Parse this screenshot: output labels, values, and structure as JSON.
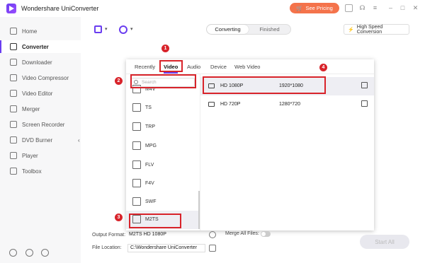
{
  "app": {
    "title": "Wondershare UniConverter",
    "pricing_label": "See Pricing"
  },
  "sidebar": {
    "items": [
      {
        "label": "Home"
      },
      {
        "label": "Converter"
      },
      {
        "label": "Downloader"
      },
      {
        "label": "Video Compressor"
      },
      {
        "label": "Video Editor"
      },
      {
        "label": "Merger"
      },
      {
        "label": "Screen Recorder"
      },
      {
        "label": "DVD Burner"
      },
      {
        "label": "Player"
      },
      {
        "label": "Toolbox"
      }
    ],
    "active": "Converter"
  },
  "toolbar": {
    "tabs": [
      "Converting",
      "Finished"
    ],
    "active_tab": "Converting",
    "high_speed_label": "High Speed Conversion"
  },
  "popup": {
    "tabs": [
      "Recently",
      "Video",
      "Audio",
      "Device",
      "Web Video"
    ],
    "active_tab": "Video",
    "search_placeholder": "Search",
    "formats": [
      "M4V",
      "TS",
      "TRP",
      "MPG",
      "FLV",
      "F4V",
      "SWF",
      "M2TS"
    ],
    "selected_format": "M2TS",
    "presets": [
      {
        "name": "HD 1080P",
        "resolution": "1920*1080"
      },
      {
        "name": "HD 720P",
        "resolution": "1280*720"
      }
    ],
    "selected_preset": "HD 1080P"
  },
  "annotations": [
    "1",
    "2",
    "3",
    "4"
  ],
  "bottom": {
    "output_format_label": "Output Format:",
    "output_format_value": "M2TS HD 1080P",
    "merge_label": "Merge All Files:",
    "file_location_label": "File Location:",
    "file_location_value": "C:\\Wondershare UniConverter",
    "start_all_label": "Start All"
  },
  "colors": {
    "accent": "#6a3df0",
    "pricing": "#f4734b",
    "annotation": "#d8232a"
  }
}
